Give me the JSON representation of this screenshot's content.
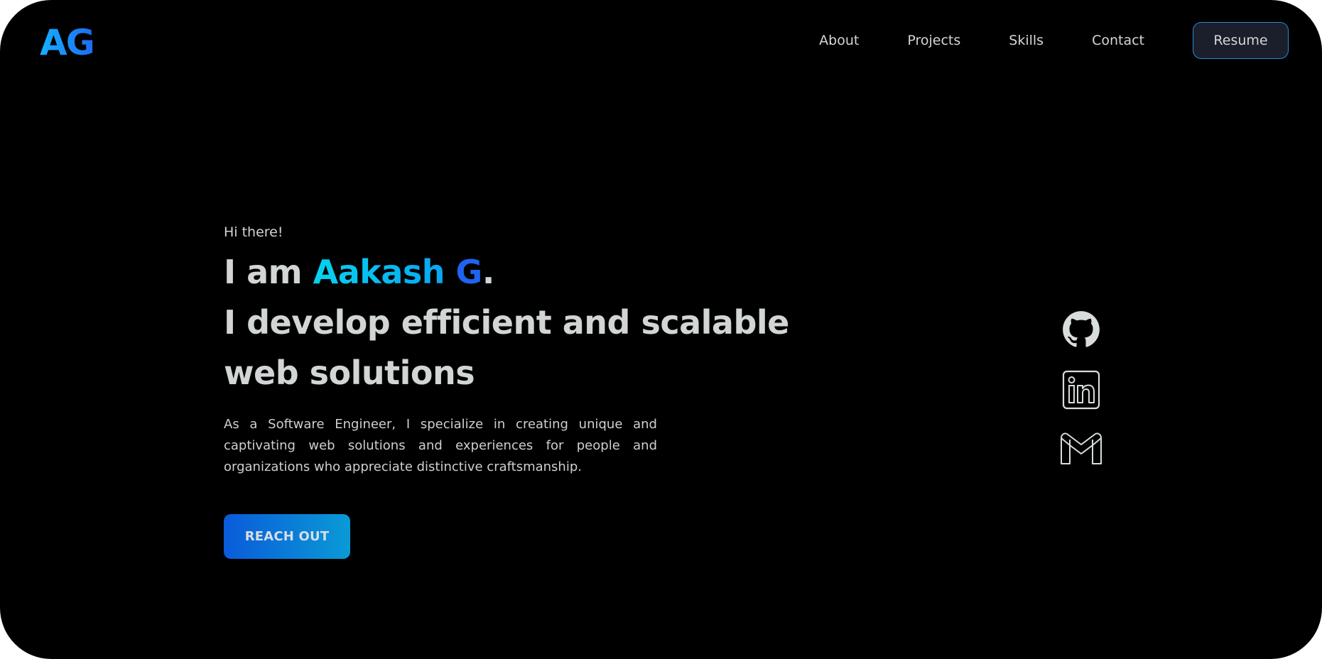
{
  "logo": {
    "text": "AG"
  },
  "nav": {
    "links": [
      "About",
      "Projects",
      "Skills",
      "Contact"
    ],
    "resume_label": "Resume"
  },
  "hero": {
    "greeting": "Hi there!",
    "headline_prefix": "I am ",
    "name_first": "Aakash",
    "name_last": "G",
    "headline_period": ".",
    "headline_line2": "I develop efficient and scalable",
    "headline_line3": "web solutions",
    "bio": "As a Software Engineer, I specialize in creating unique and captivating web solutions and experiences for people and organizations who appreciate distinctive craftsmanship.",
    "cta_label": "REACH OUT"
  },
  "social": {
    "icons": [
      "github-icon",
      "linkedin-icon",
      "gmail-icon"
    ]
  },
  "colors": {
    "background": "#000000",
    "accent_blue": "#1f63ee",
    "accent_cyan": "#05d2ee",
    "text": "#d2d5d5"
  }
}
